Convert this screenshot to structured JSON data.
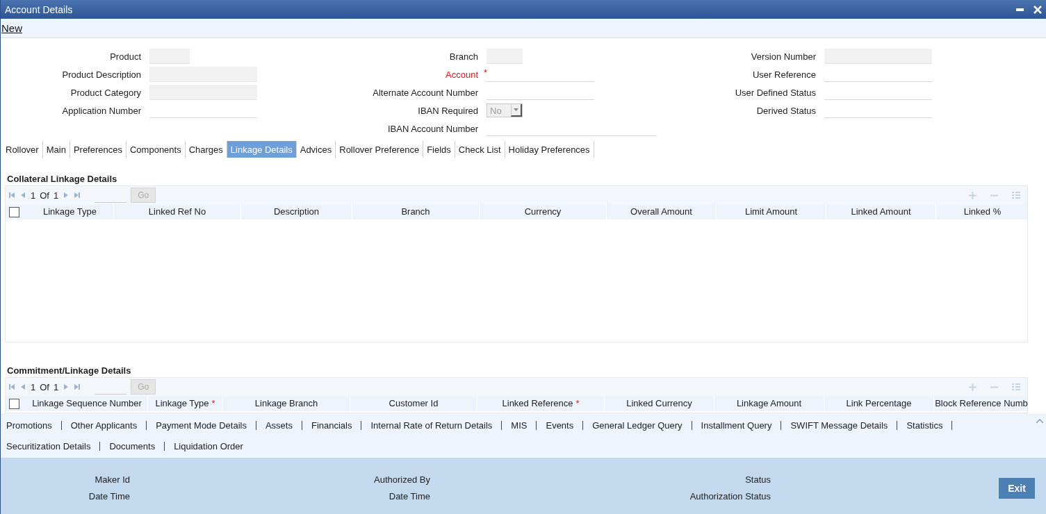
{
  "window": {
    "title": "Account Details"
  },
  "toolbar": {
    "new_link": "New"
  },
  "form": {
    "columns": [
      [
        {
          "label": "Product",
          "kind": "short",
          "required": false
        },
        {
          "label": "Product Description",
          "kind": "readonly",
          "required": false
        },
        {
          "label": "Product Category",
          "kind": "readonly",
          "required": false
        },
        {
          "label": "Application Number",
          "kind": "text",
          "required": false
        }
      ],
      [
        {
          "label": "Branch",
          "kind": "short",
          "required": false
        },
        {
          "label": "Account",
          "kind": "text",
          "required": true,
          "mark": "*"
        },
        {
          "label": "Alternate Account Number",
          "kind": "text",
          "required": false
        },
        {
          "label": "IBAN Required",
          "kind": "select",
          "required": false,
          "value": "No"
        },
        {
          "label": "IBAN Account Number",
          "kind": "long",
          "required": false
        }
      ],
      [
        {
          "label": "Version Number",
          "kind": "readonly",
          "required": false
        },
        {
          "label": "User Reference",
          "kind": "text",
          "required": false
        },
        {
          "label": "User Defined Status",
          "kind": "text",
          "required": false
        },
        {
          "label": "Derived Status",
          "kind": "text",
          "required": false
        }
      ]
    ]
  },
  "tabs": [
    {
      "label": "Rollover",
      "selected": false
    },
    {
      "label": "Main",
      "selected": false
    },
    {
      "label": "Preferences",
      "selected": false
    },
    {
      "label": "Components",
      "selected": false
    },
    {
      "label": "Charges",
      "selected": false
    },
    {
      "label": "Linkage Details",
      "selected": true
    },
    {
      "label": "Advices",
      "selected": false
    },
    {
      "label": "Rollover Preference",
      "selected": false
    },
    {
      "label": "Fields",
      "selected": false
    },
    {
      "label": "Check List",
      "selected": false
    },
    {
      "label": "Holiday Preferences",
      "selected": false
    }
  ],
  "grids": [
    {
      "title": "Collateral Linkage Details",
      "pager": {
        "page": "1",
        "of": "Of",
        "total": "1",
        "go": "Go"
      },
      "checked": false,
      "columns": [
        {
          "label": "Linkage Type",
          "required": false
        },
        {
          "label": "Linked Ref No",
          "required": false
        },
        {
          "label": "Description",
          "required": false
        },
        {
          "label": "Branch",
          "required": false
        },
        {
          "label": "Currency",
          "required": false
        },
        {
          "label": "Overall Amount",
          "required": false
        },
        {
          "label": "Limit Amount",
          "required": false
        },
        {
          "label": "Linked Amount",
          "required": false
        },
        {
          "label": "Linked %",
          "required": false
        }
      ]
    },
    {
      "title": "Commitment/Linkage Details",
      "pager": {
        "page": "1",
        "of": "Of",
        "total": "1",
        "go": "Go"
      },
      "checked": false,
      "columns": [
        {
          "label": "Linkage Sequence Number",
          "required": false
        },
        {
          "label": "Linkage Type",
          "required": true
        },
        {
          "label": "Linkage Branch",
          "required": false
        },
        {
          "label": "Customer Id",
          "required": false
        },
        {
          "label": "Linked Reference",
          "required": true
        },
        {
          "label": "Linked Currency",
          "required": false
        },
        {
          "label": "Linkage Amount",
          "required": false
        },
        {
          "label": "Link Percentage",
          "required": false
        },
        {
          "label": "Block Reference Numb",
          "required": false
        }
      ]
    }
  ],
  "footer_links": [
    [
      "Promotions",
      "Other Applicants",
      "Payment Mode Details",
      "Assets",
      "Financials",
      "Internal Rate of Return Details",
      "MIS",
      "Events",
      "General Ledger Query",
      "Installment Query",
      "SWIFT Message Details",
      "Statistics"
    ],
    [
      "Securitization Details",
      "Documents",
      "Liquidation Order"
    ]
  ],
  "audit": [
    [
      "Maker Id",
      "Date Time"
    ],
    [
      "Authorized By",
      "Date Time"
    ],
    [
      "Status",
      "Authorization Status"
    ]
  ],
  "exit_button": "Exit"
}
